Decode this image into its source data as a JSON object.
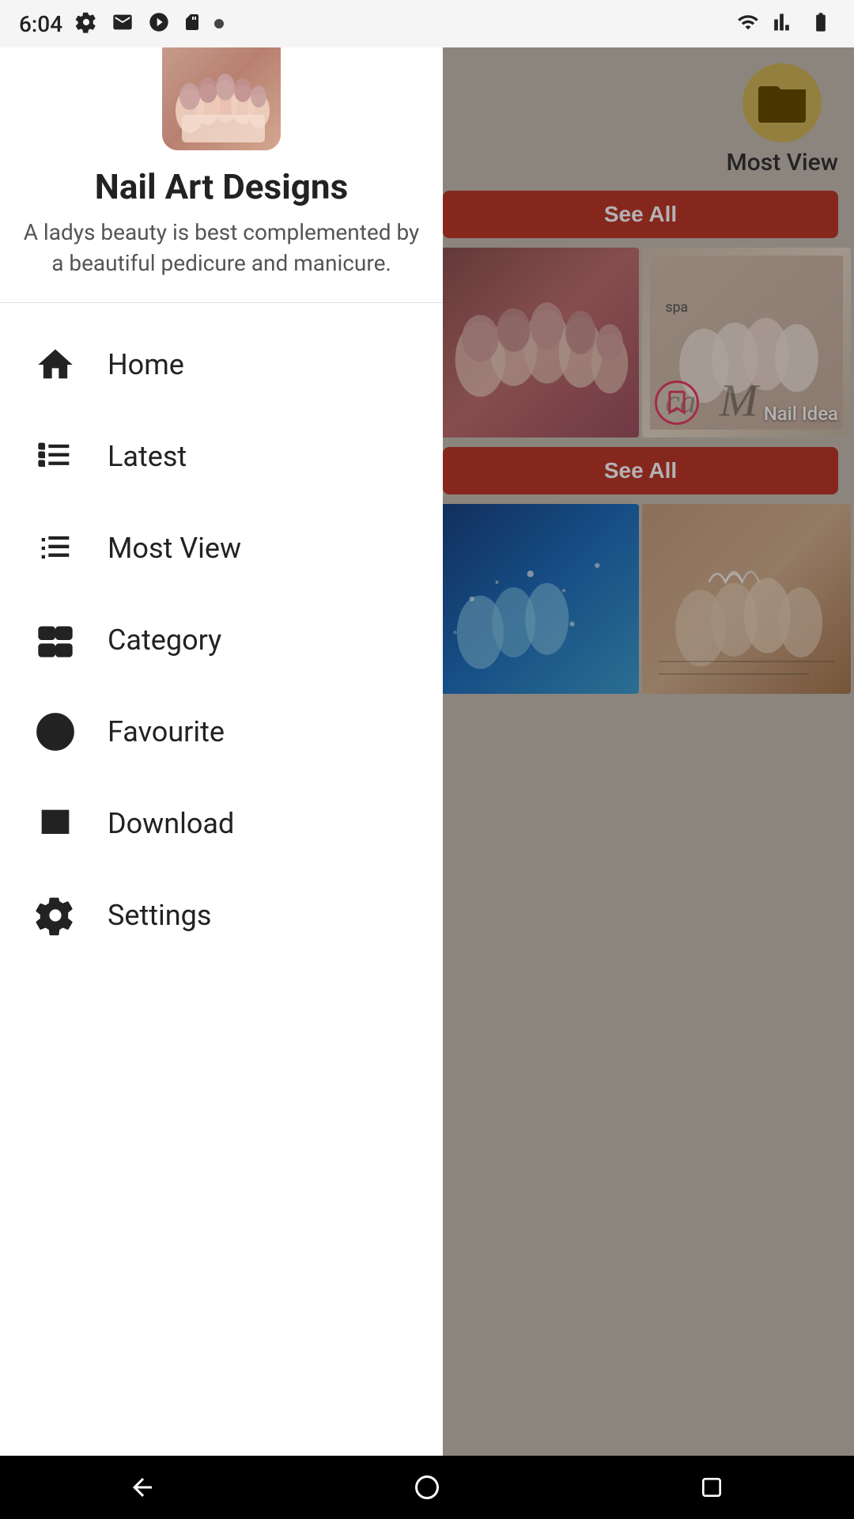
{
  "statusBar": {
    "time": "6:04",
    "leftIcons": [
      "gear-icon",
      "mail-icon",
      "play-icon",
      "sd-icon",
      "dot-icon"
    ],
    "rightIcons": [
      "wifi-icon",
      "signal-icon",
      "battery-icon"
    ]
  },
  "app": {
    "title": "Nail Art Designs",
    "subtitle": "A ladys beauty is best complemented by a beautiful pedicure and manicure.",
    "logoAlt": "Nail Art Designs logo"
  },
  "navItems": [
    {
      "id": "home",
      "label": "Home",
      "icon": "home-icon"
    },
    {
      "id": "latest",
      "label": "Latest",
      "icon": "latest-icon"
    },
    {
      "id": "most-view",
      "label": "Most View",
      "icon": "most-view-icon"
    },
    {
      "id": "category",
      "label": "Category",
      "icon": "category-icon"
    },
    {
      "id": "favourite",
      "label": "Favourite",
      "icon": "favourite-icon"
    },
    {
      "id": "download",
      "label": "Download",
      "icon": "download-icon"
    },
    {
      "id": "settings",
      "label": "Settings",
      "icon": "settings-icon"
    }
  ],
  "rightPanel": {
    "mostViewLabel": "Most View",
    "seeAllLabel1": "See All",
    "seeAllLabel2": "See All",
    "nailIdeaLabel": "Nail Idea"
  },
  "navBar": {
    "backLabel": "◀",
    "homeLabel": "●",
    "recentLabel": "■"
  }
}
